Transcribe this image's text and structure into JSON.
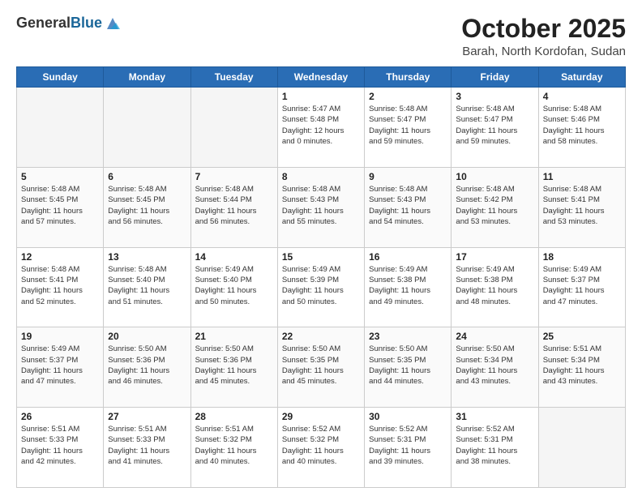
{
  "header": {
    "logo_general": "General",
    "logo_blue": "Blue",
    "month_year": "October 2025",
    "location": "Barah, North Kordofan, Sudan"
  },
  "days_of_week": [
    "Sunday",
    "Monday",
    "Tuesday",
    "Wednesday",
    "Thursday",
    "Friday",
    "Saturday"
  ],
  "weeks": [
    [
      {
        "day": "",
        "info": ""
      },
      {
        "day": "",
        "info": ""
      },
      {
        "day": "",
        "info": ""
      },
      {
        "day": "1",
        "info": "Sunrise: 5:47 AM\nSunset: 5:48 PM\nDaylight: 12 hours\nand 0 minutes."
      },
      {
        "day": "2",
        "info": "Sunrise: 5:48 AM\nSunset: 5:47 PM\nDaylight: 11 hours\nand 59 minutes."
      },
      {
        "day": "3",
        "info": "Sunrise: 5:48 AM\nSunset: 5:47 PM\nDaylight: 11 hours\nand 59 minutes."
      },
      {
        "day": "4",
        "info": "Sunrise: 5:48 AM\nSunset: 5:46 PM\nDaylight: 11 hours\nand 58 minutes."
      }
    ],
    [
      {
        "day": "5",
        "info": "Sunrise: 5:48 AM\nSunset: 5:45 PM\nDaylight: 11 hours\nand 57 minutes."
      },
      {
        "day": "6",
        "info": "Sunrise: 5:48 AM\nSunset: 5:45 PM\nDaylight: 11 hours\nand 56 minutes."
      },
      {
        "day": "7",
        "info": "Sunrise: 5:48 AM\nSunset: 5:44 PM\nDaylight: 11 hours\nand 56 minutes."
      },
      {
        "day": "8",
        "info": "Sunrise: 5:48 AM\nSunset: 5:43 PM\nDaylight: 11 hours\nand 55 minutes."
      },
      {
        "day": "9",
        "info": "Sunrise: 5:48 AM\nSunset: 5:43 PM\nDaylight: 11 hours\nand 54 minutes."
      },
      {
        "day": "10",
        "info": "Sunrise: 5:48 AM\nSunset: 5:42 PM\nDaylight: 11 hours\nand 53 minutes."
      },
      {
        "day": "11",
        "info": "Sunrise: 5:48 AM\nSunset: 5:41 PM\nDaylight: 11 hours\nand 53 minutes."
      }
    ],
    [
      {
        "day": "12",
        "info": "Sunrise: 5:48 AM\nSunset: 5:41 PM\nDaylight: 11 hours\nand 52 minutes."
      },
      {
        "day": "13",
        "info": "Sunrise: 5:48 AM\nSunset: 5:40 PM\nDaylight: 11 hours\nand 51 minutes."
      },
      {
        "day": "14",
        "info": "Sunrise: 5:49 AM\nSunset: 5:40 PM\nDaylight: 11 hours\nand 50 minutes."
      },
      {
        "day": "15",
        "info": "Sunrise: 5:49 AM\nSunset: 5:39 PM\nDaylight: 11 hours\nand 50 minutes."
      },
      {
        "day": "16",
        "info": "Sunrise: 5:49 AM\nSunset: 5:38 PM\nDaylight: 11 hours\nand 49 minutes."
      },
      {
        "day": "17",
        "info": "Sunrise: 5:49 AM\nSunset: 5:38 PM\nDaylight: 11 hours\nand 48 minutes."
      },
      {
        "day": "18",
        "info": "Sunrise: 5:49 AM\nSunset: 5:37 PM\nDaylight: 11 hours\nand 47 minutes."
      }
    ],
    [
      {
        "day": "19",
        "info": "Sunrise: 5:49 AM\nSunset: 5:37 PM\nDaylight: 11 hours\nand 47 minutes."
      },
      {
        "day": "20",
        "info": "Sunrise: 5:50 AM\nSunset: 5:36 PM\nDaylight: 11 hours\nand 46 minutes."
      },
      {
        "day": "21",
        "info": "Sunrise: 5:50 AM\nSunset: 5:36 PM\nDaylight: 11 hours\nand 45 minutes."
      },
      {
        "day": "22",
        "info": "Sunrise: 5:50 AM\nSunset: 5:35 PM\nDaylight: 11 hours\nand 45 minutes."
      },
      {
        "day": "23",
        "info": "Sunrise: 5:50 AM\nSunset: 5:35 PM\nDaylight: 11 hours\nand 44 minutes."
      },
      {
        "day": "24",
        "info": "Sunrise: 5:50 AM\nSunset: 5:34 PM\nDaylight: 11 hours\nand 43 minutes."
      },
      {
        "day": "25",
        "info": "Sunrise: 5:51 AM\nSunset: 5:34 PM\nDaylight: 11 hours\nand 43 minutes."
      }
    ],
    [
      {
        "day": "26",
        "info": "Sunrise: 5:51 AM\nSunset: 5:33 PM\nDaylight: 11 hours\nand 42 minutes."
      },
      {
        "day": "27",
        "info": "Sunrise: 5:51 AM\nSunset: 5:33 PM\nDaylight: 11 hours\nand 41 minutes."
      },
      {
        "day": "28",
        "info": "Sunrise: 5:51 AM\nSunset: 5:32 PM\nDaylight: 11 hours\nand 40 minutes."
      },
      {
        "day": "29",
        "info": "Sunrise: 5:52 AM\nSunset: 5:32 PM\nDaylight: 11 hours\nand 40 minutes."
      },
      {
        "day": "30",
        "info": "Sunrise: 5:52 AM\nSunset: 5:31 PM\nDaylight: 11 hours\nand 39 minutes."
      },
      {
        "day": "31",
        "info": "Sunrise: 5:52 AM\nSunset: 5:31 PM\nDaylight: 11 hours\nand 38 minutes."
      },
      {
        "day": "",
        "info": ""
      }
    ]
  ]
}
